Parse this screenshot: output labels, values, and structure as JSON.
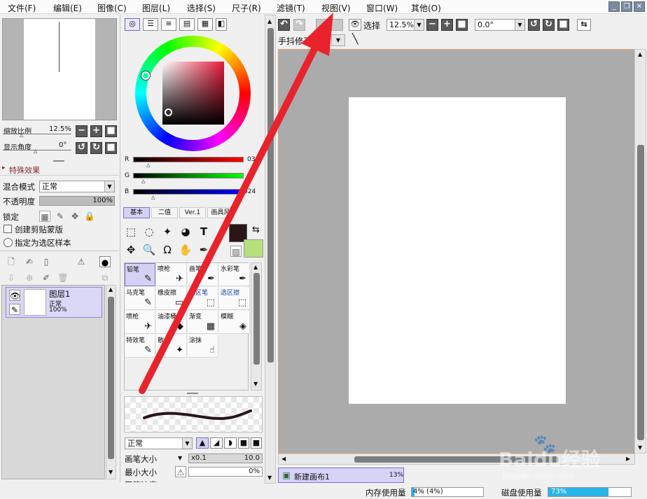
{
  "menu": {
    "items": [
      "文件(F)",
      "编辑(E)",
      "图像(C)",
      "图层(L)",
      "选择(S)",
      "尺子(R)",
      "滤镜(T)",
      "视图(V)",
      "窗口(W)",
      "其他(O)"
    ],
    "minimize": "_",
    "restore": "❐",
    "close": "✕"
  },
  "navigator": {
    "zoom_label": "缩放比例",
    "zoom_value": "12.5%",
    "angle_label": "显示角度",
    "angle_value": "0°"
  },
  "effects": {
    "title": "特殊效果"
  },
  "layer_props": {
    "blend_label": "混合模式",
    "blend_value": "正常",
    "opacity_label": "不透明度",
    "opacity_value": "100%",
    "opacity_fraction": 1.0,
    "lock_label": "锁定",
    "clip_label": "创建剪贴蒙版",
    "selection_label": "指定为选区样本"
  },
  "layers": [
    {
      "name": "图层1",
      "mode": "正常",
      "opacity": "100%"
    }
  ],
  "color": {
    "r_label": "R",
    "g_label": "G",
    "b_label": "B",
    "r_value": "03",
    "g_value": "",
    "b_value": "024",
    "fg_color": "#2a1518",
    "bg_color": "#b6e07a"
  },
  "tool_tabs": [
    "基本",
    "二值",
    "Ver.1",
    "画具风"
  ],
  "brushes": [
    {
      "name": "铅笔",
      "icon": "✎"
    },
    {
      "name": "喷枪",
      "icon": "✈"
    },
    {
      "name": "画笔",
      "icon": "✒"
    },
    {
      "name": "水彩笔",
      "icon": "✒"
    },
    {
      "name": "马克笔",
      "icon": "✎"
    },
    {
      "name": "橡皮擦",
      "icon": "▭"
    },
    {
      "name": "选区笔",
      "icon": "⬚"
    },
    {
      "name": "选区擦",
      "icon": "⬚"
    },
    {
      "name": "喷枪",
      "icon": "✈"
    },
    {
      "name": "油漆桶",
      "icon": "◆"
    },
    {
      "name": "渐变",
      "icon": "▦"
    },
    {
      "name": "模糊",
      "icon": "◈"
    },
    {
      "name": "特效笔",
      "icon": "✎"
    },
    {
      "name": "散点",
      "icon": "✦"
    },
    {
      "name": "涂抹",
      "icon": "☝"
    }
  ],
  "brush_props": {
    "mode_value": "正常",
    "size_label": "画笔大小",
    "size_mult": "x0.1",
    "size_value": "10.0",
    "min_label": "最小大小",
    "min_value": "0%",
    "density_label": "画笔浓度"
  },
  "toolbar": {
    "select_label": "选择",
    "zoom_value": "12.5%",
    "angle_value": "0.0°",
    "stabilizer_label": "手抖修正"
  },
  "status": {
    "doc_name": "新建画布1",
    "doc_zoom": "13%",
    "mem_label": "内存使用量",
    "mem_value": "4% (4%)",
    "mem_fraction": 0.04,
    "disk_label": "磁盘使用量",
    "disk_value": "73%",
    "disk_fraction": 0.73
  },
  "watermark": {
    "text": "Baidu经验",
    "subtext": "jingyan.baidu.com"
  }
}
